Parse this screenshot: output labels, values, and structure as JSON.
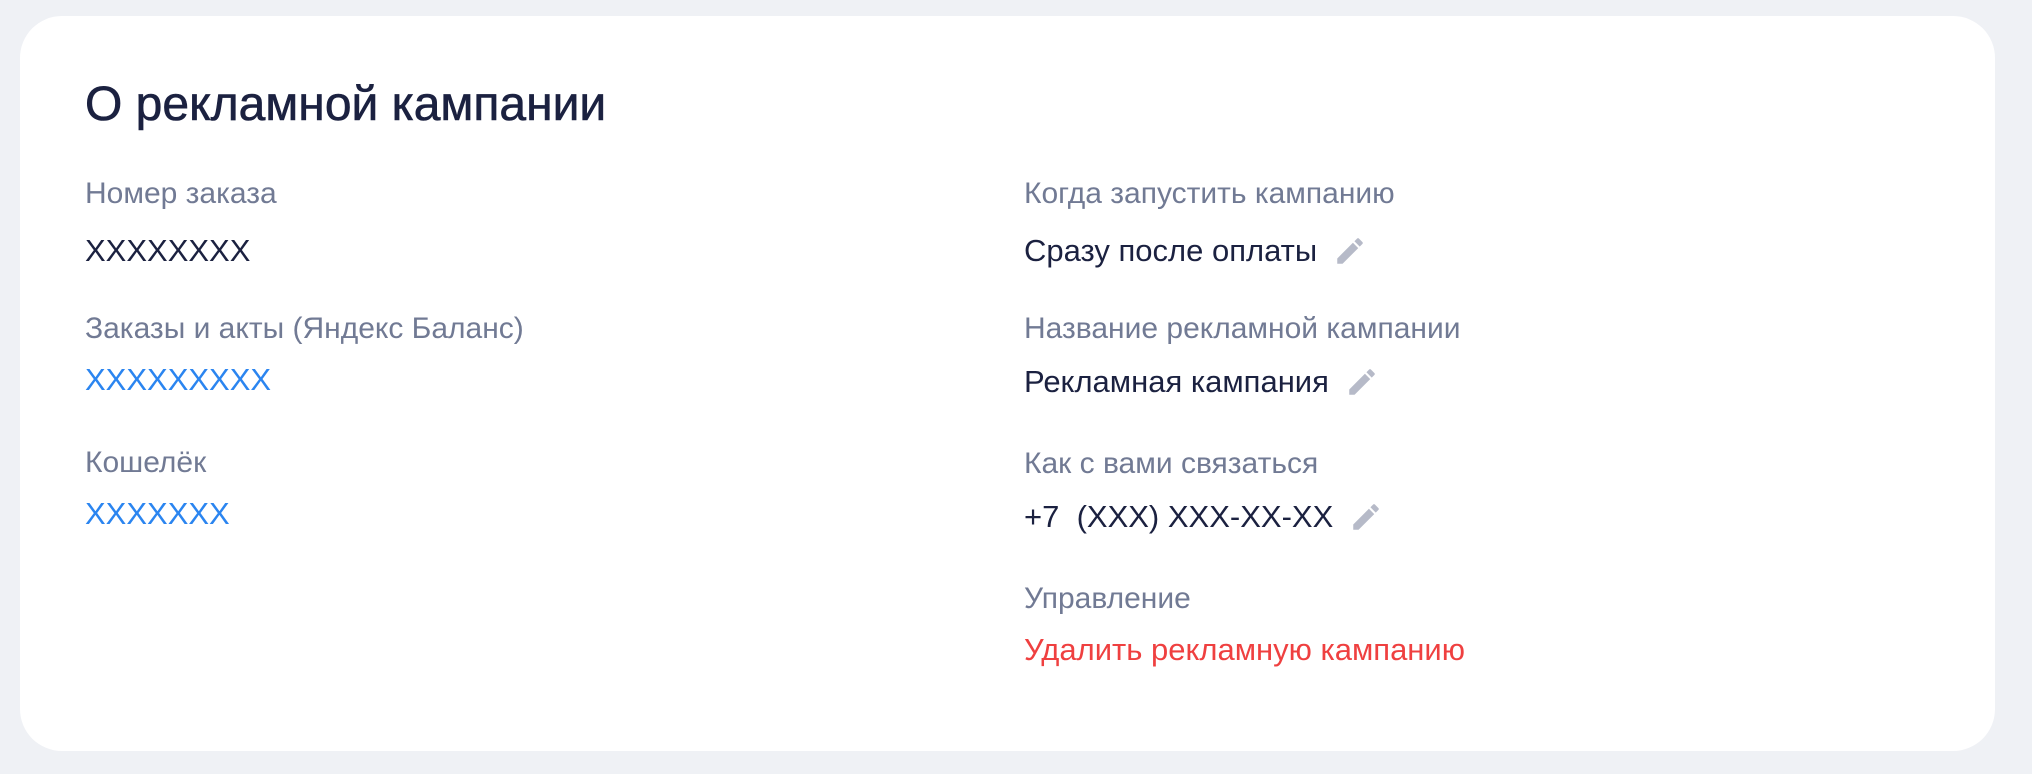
{
  "section": {
    "title": "О рекламной кампании"
  },
  "left": {
    "order_number": {
      "label": "Номер заказа",
      "value": "XXXXXXXX"
    },
    "orders_acts": {
      "label": "Заказы и акты (Яндекс Баланс)",
      "value": "XXXXXXXXX"
    },
    "wallet": {
      "label": "Кошелёк",
      "value": "XXXXXXX"
    }
  },
  "right": {
    "launch": {
      "label": "Когда запустить кампанию",
      "value": "Сразу после оплаты",
      "icon": "pencil-icon"
    },
    "campaign_name": {
      "label": "Название рекламной кампании",
      "value": "Рекламная кампания",
      "icon": "pencil-icon"
    },
    "contact": {
      "label": "Как с вами связаться",
      "value": "+7  (XXX) XXX-XX-XX",
      "icon": "pencil-icon"
    },
    "management": {
      "label": "Управление",
      "action": "Удалить рекламную кампанию"
    }
  },
  "colors": {
    "page_background": "#eff1f5",
    "card_background": "#ffffff",
    "heading": "#1b2140",
    "label": "#717a94",
    "link": "#2b85f0",
    "danger": "#ef4040",
    "icon": "#b6bac8"
  }
}
